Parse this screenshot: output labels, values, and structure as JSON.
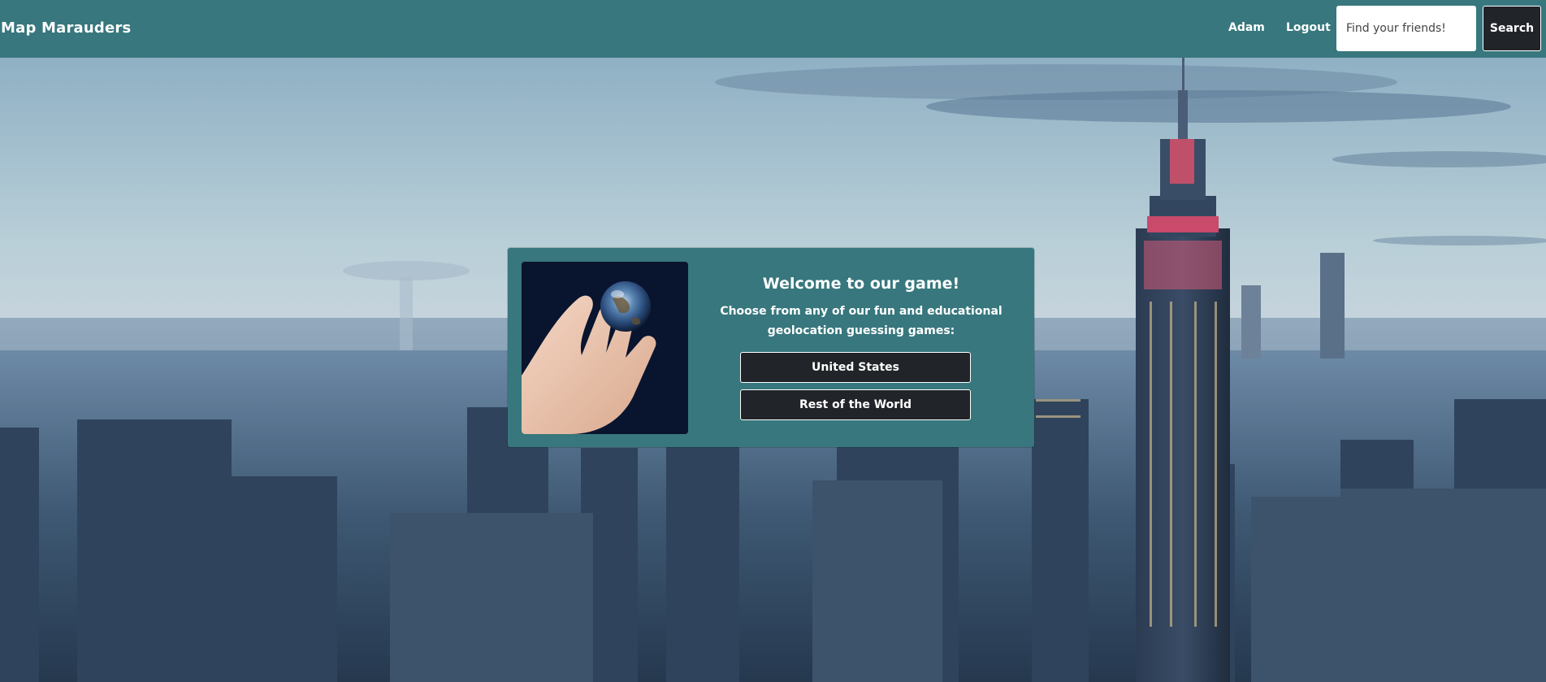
{
  "navbar": {
    "brand": "Map Marauders",
    "user_link": "Adam",
    "logout_link": "Logout",
    "search": {
      "placeholder": "Find your friends!",
      "button_label": "Search"
    },
    "color": "#37777d"
  },
  "card": {
    "title": "Welcome to our game!",
    "description": "Choose from any of our fun and educational geolocation guessing games:",
    "buttons": [
      {
        "label": "United States"
      },
      {
        "label": "Rest of the World"
      }
    ],
    "image": "hand-holding-globe"
  },
  "background": {
    "scene": "city-skyline"
  }
}
